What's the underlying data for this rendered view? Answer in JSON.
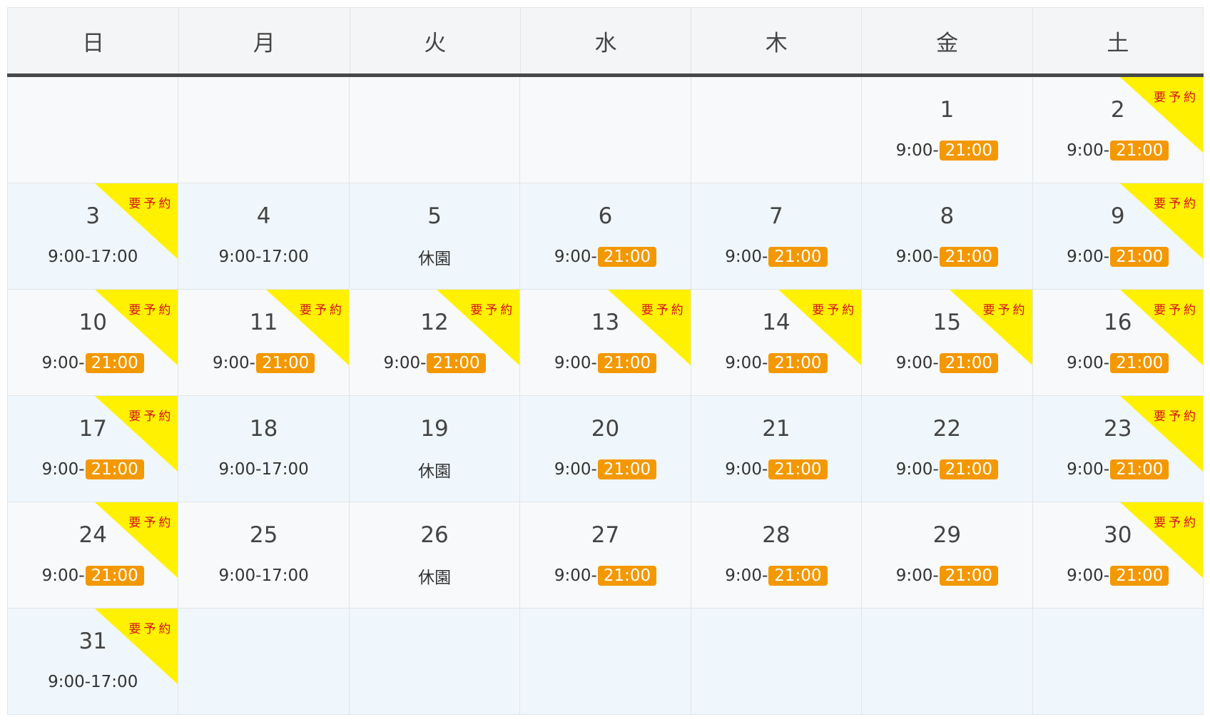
{
  "weekdays": [
    "日",
    "月",
    "火",
    "水",
    "木",
    "金",
    "土"
  ],
  "labels": {
    "reservation": "要予約",
    "closed": "休園",
    "open": "9:00-"
  },
  "colors": {
    "pill": "#f39800",
    "ribbon": "#fff100",
    "ribbon_text": "#d6101e",
    "header_bar": "#47484a"
  },
  "days": [
    {
      "date": "1",
      "type": "night",
      "reserve": false,
      "hours_start": "9:00-",
      "hours_end": "21:00"
    },
    {
      "date": "2",
      "type": "night",
      "reserve": true,
      "hours_start": "9:00-",
      "hours_end": "21:00"
    },
    {
      "date": "3",
      "type": "day",
      "reserve": true,
      "hours": "9:00-17:00"
    },
    {
      "date": "4",
      "type": "day",
      "reserve": false,
      "hours": "9:00-17:00"
    },
    {
      "date": "5",
      "type": "closed",
      "reserve": false,
      "text": "休園"
    },
    {
      "date": "6",
      "type": "night",
      "reserve": false,
      "hours_start": "9:00-",
      "hours_end": "21:00"
    },
    {
      "date": "7",
      "type": "night",
      "reserve": false,
      "hours_start": "9:00-",
      "hours_end": "21:00"
    },
    {
      "date": "8",
      "type": "night",
      "reserve": false,
      "hours_start": "9:00-",
      "hours_end": "21:00"
    },
    {
      "date": "9",
      "type": "night",
      "reserve": true,
      "hours_start": "9:00-",
      "hours_end": "21:00"
    },
    {
      "date": "10",
      "type": "night",
      "reserve": true,
      "hours_start": "9:00-",
      "hours_end": "21:00"
    },
    {
      "date": "11",
      "type": "night",
      "reserve": true,
      "hours_start": "9:00-",
      "hours_end": "21:00"
    },
    {
      "date": "12",
      "type": "night",
      "reserve": true,
      "hours_start": "9:00-",
      "hours_end": "21:00"
    },
    {
      "date": "13",
      "type": "night",
      "reserve": true,
      "hours_start": "9:00-",
      "hours_end": "21:00"
    },
    {
      "date": "14",
      "type": "night",
      "reserve": true,
      "hours_start": "9:00-",
      "hours_end": "21:00"
    },
    {
      "date": "15",
      "type": "night",
      "reserve": true,
      "hours_start": "9:00-",
      "hours_end": "21:00"
    },
    {
      "date": "16",
      "type": "night",
      "reserve": true,
      "hours_start": "9:00-",
      "hours_end": "21:00"
    },
    {
      "date": "17",
      "type": "night",
      "reserve": true,
      "hours_start": "9:00-",
      "hours_end": "21:00"
    },
    {
      "date": "18",
      "type": "day",
      "reserve": false,
      "hours": "9:00-17:00"
    },
    {
      "date": "19",
      "type": "closed",
      "reserve": false,
      "text": "休園"
    },
    {
      "date": "20",
      "type": "night",
      "reserve": false,
      "hours_start": "9:00-",
      "hours_end": "21:00"
    },
    {
      "date": "21",
      "type": "night",
      "reserve": false,
      "hours_start": "9:00-",
      "hours_end": "21:00"
    },
    {
      "date": "22",
      "type": "night",
      "reserve": false,
      "hours_start": "9:00-",
      "hours_end": "21:00"
    },
    {
      "date": "23",
      "type": "night",
      "reserve": true,
      "hours_start": "9:00-",
      "hours_end": "21:00"
    },
    {
      "date": "24",
      "type": "night",
      "reserve": true,
      "hours_start": "9:00-",
      "hours_end": "21:00"
    },
    {
      "date": "25",
      "type": "day",
      "reserve": false,
      "hours": "9:00-17:00"
    },
    {
      "date": "26",
      "type": "closed",
      "reserve": false,
      "text": "休園"
    },
    {
      "date": "27",
      "type": "night",
      "reserve": false,
      "hours_start": "9:00-",
      "hours_end": "21:00"
    },
    {
      "date": "28",
      "type": "night",
      "reserve": false,
      "hours_start": "9:00-",
      "hours_end": "21:00"
    },
    {
      "date": "29",
      "type": "night",
      "reserve": false,
      "hours_start": "9:00-",
      "hours_end": "21:00"
    },
    {
      "date": "30",
      "type": "night",
      "reserve": true,
      "hours_start": "9:00-",
      "hours_end": "21:00"
    },
    {
      "date": "31",
      "type": "day",
      "reserve": true,
      "hours": "9:00-17:00"
    }
  ]
}
